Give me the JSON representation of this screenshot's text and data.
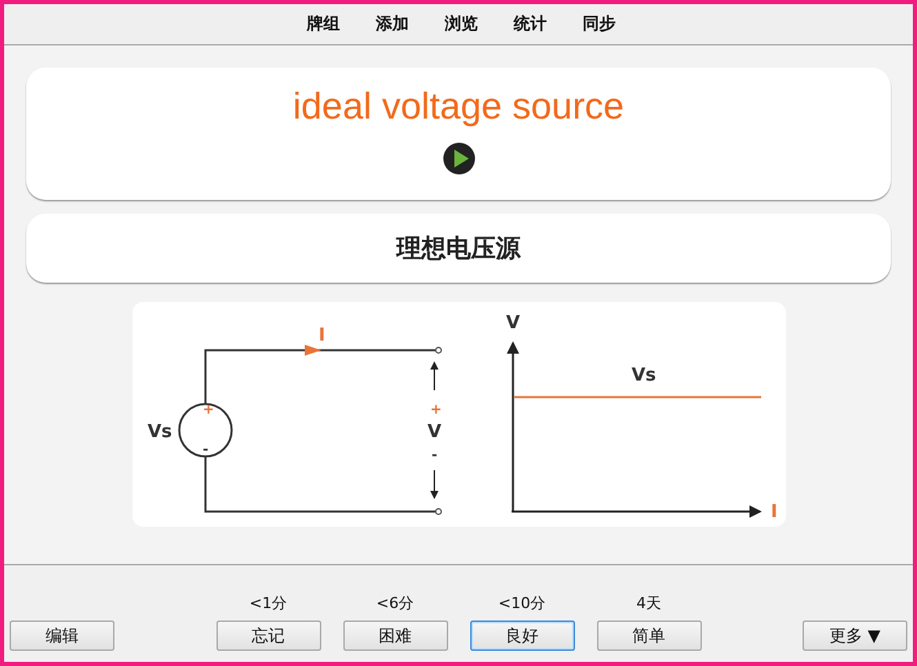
{
  "menu": [
    {
      "label": "牌组"
    },
    {
      "label": "添加"
    },
    {
      "label": "浏览"
    },
    {
      "label": "统计"
    },
    {
      "label": "同步"
    }
  ],
  "card": {
    "front": "ideal voltage source",
    "back": "理想电压源",
    "diagram": {
      "source_label": "Vs",
      "source_plus": "+",
      "source_minus": "-",
      "current_label": "I",
      "terminal_plus": "+",
      "voltage_label": "V",
      "terminal_minus": "-",
      "plot_y_label": "V",
      "plot_x_label": "I",
      "plot_line_label": "Vs"
    }
  },
  "bottom": {
    "edit": "编辑",
    "more": "更多 ▼",
    "answers": [
      {
        "time": "<1分",
        "label": "忘记",
        "selected": false
      },
      {
        "time": "<6分",
        "label": "困难",
        "selected": false
      },
      {
        "time": "<10分",
        "label": "良好",
        "selected": true
      },
      {
        "time": "4天",
        "label": "简单",
        "selected": false
      }
    ]
  }
}
